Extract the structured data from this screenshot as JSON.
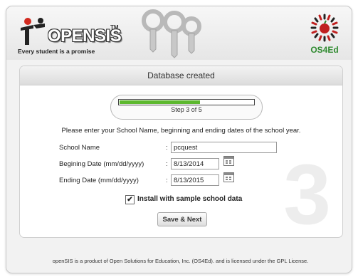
{
  "header": {
    "logo_name": "OPENSIS",
    "logo_tm": "TM",
    "tagline": "Every student is a promise",
    "badge_label": "OS4Ed"
  },
  "panel": {
    "title": "Database created",
    "step_label": "Step 3 of 5",
    "progress_fraction": 0.6,
    "big_step_number": "3",
    "instructions": "Please enter your School Name, beginning and ending dates of the school year."
  },
  "form": {
    "school_name_label": "School Name",
    "school_name_value": "pcquest",
    "begin_date_label": "Begining Date (mm/dd/yyyy)",
    "begin_date_value": "8/13/2014",
    "end_date_label": "Ending Date (mm/dd/yyyy)",
    "end_date_value": "8/13/2015",
    "colon": ":",
    "sample_data_label": "Install with sample school data",
    "sample_data_checked": true,
    "save_button": "Save & Next"
  },
  "footer": {
    "text": "openSIS is a product of Open Solutions for Education, Inc. (OS4Ed). and is licensed under the GPL License."
  },
  "colors": {
    "progress": "#5cb82e",
    "badge_green": "#2f8a2f",
    "badge_red": "#c0201f"
  },
  "icons": {
    "logo": "opensis-figure-icon",
    "keys": "keys-icon",
    "badge": "os4ed-apple-icon",
    "calendar": "calendar-icon",
    "checkbox": "checkmark-icon"
  }
}
